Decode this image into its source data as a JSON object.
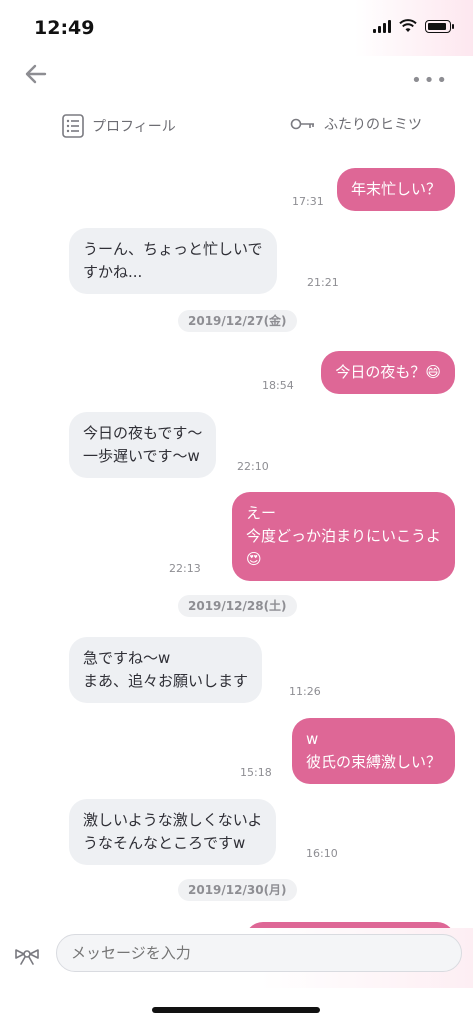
{
  "status": {
    "time": "12:49"
  },
  "nav": {
    "more_label": "•••"
  },
  "tabs": {
    "profile": "プロフィール",
    "secret": "ふたりのヒミツ"
  },
  "messages": [
    {
      "text": "年末忙しい？",
      "time": "17:31"
    },
    {
      "text": "うーん、ちょっと忙しいで\nすかね...",
      "time": "21:21"
    },
    {
      "date": "2019/12/27(金)"
    },
    {
      "text": "今日の夜も？😄",
      "time": "18:54"
    },
    {
      "text": "今日の夜もです〜\n一歩遅いです〜w",
      "time": "22:10"
    },
    {
      "text": "えー\n今度どっか泊まりにいこうよ\n😍",
      "time": "22:13"
    },
    {
      "date": "2019/12/28(土)"
    },
    {
      "text": "急ですね〜w\nまあ、追々お願いします",
      "time": "11:26"
    },
    {
      "text": "w\n彼氏の束縛激しい？",
      "time": "15:18"
    },
    {
      "text": "激しいような激しくないよ\nうなそんなところですw",
      "time": "16:10"
    },
    {
      "date": "2019/12/30(月)"
    }
  ],
  "composer": {
    "placeholder": "メッセージを入力"
  },
  "colors": {
    "outgoing": "#de6796",
    "incoming": "#eef0f3"
  }
}
